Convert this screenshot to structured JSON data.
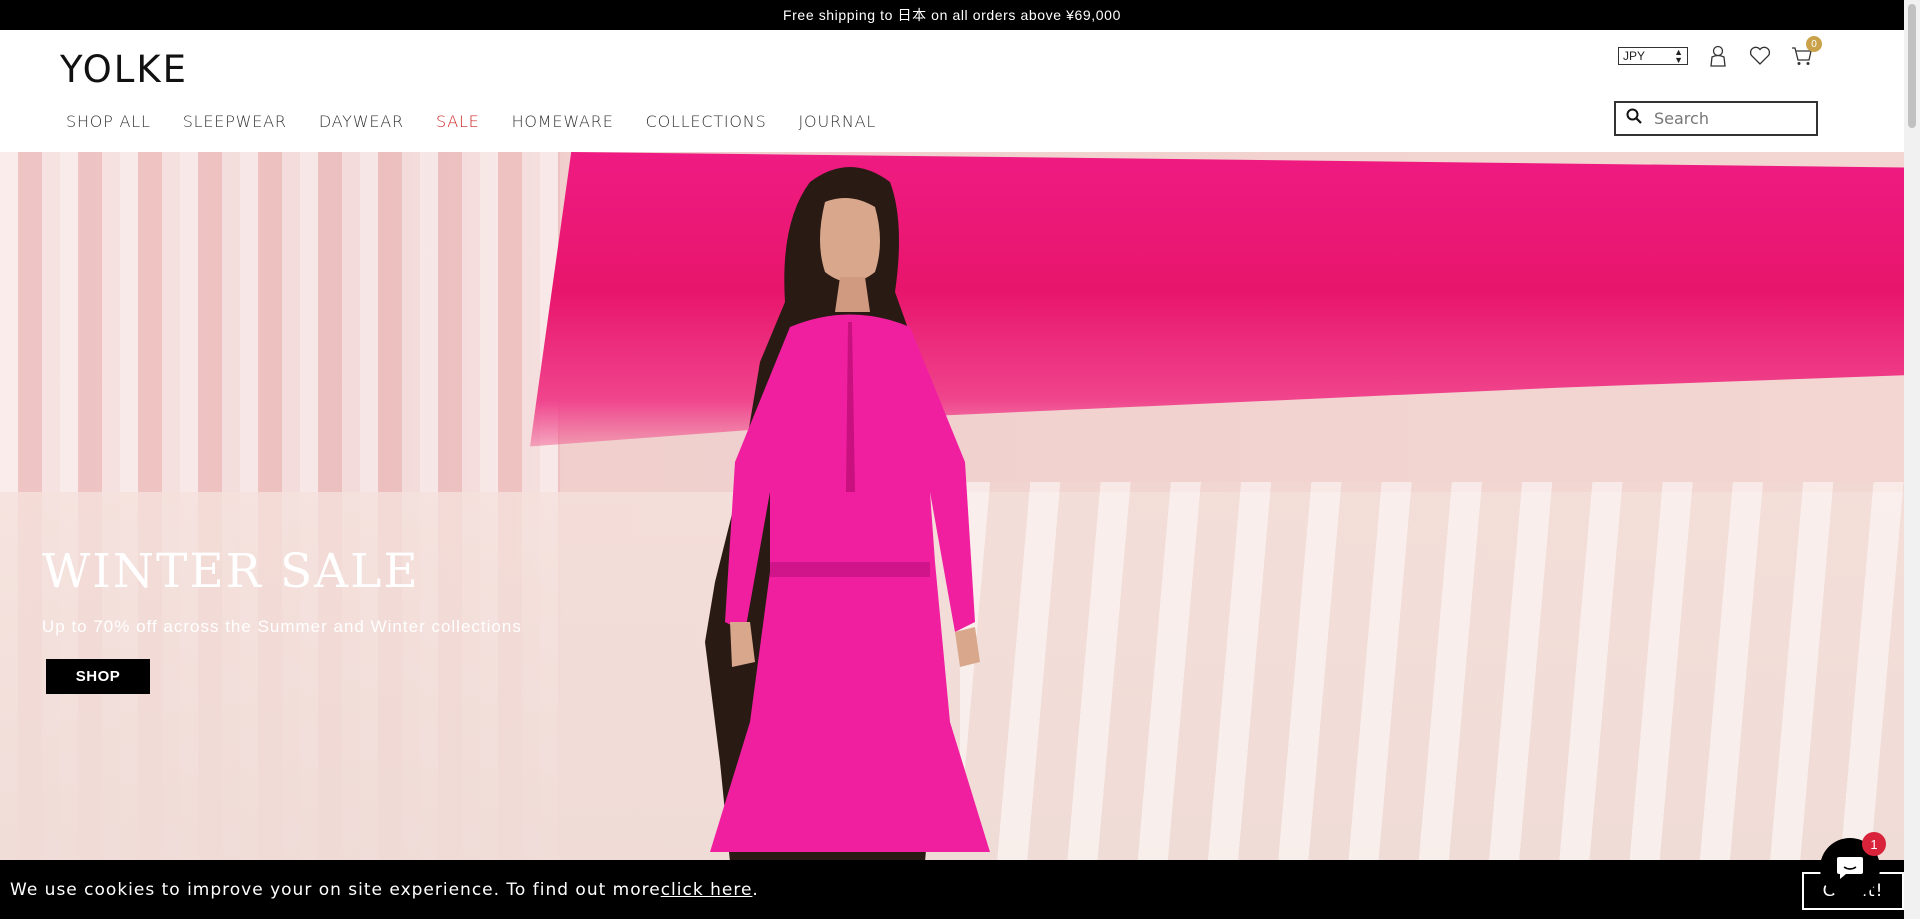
{
  "announcement": "Free shipping to 日本 on all orders above ¥69,000",
  "brand": "YOLKE",
  "nav": {
    "items": [
      {
        "label": "SHOP ALL"
      },
      {
        "label": "SLEEPWEAR"
      },
      {
        "label": "DAYWEAR"
      },
      {
        "label": "SALE"
      },
      {
        "label": "HOMEWARE"
      },
      {
        "label": "COLLECTIONS"
      },
      {
        "label": "JOURNAL"
      }
    ],
    "sale_color": "#cc2222"
  },
  "utils": {
    "currency": "JPY",
    "cart_count": "0",
    "icons": [
      "account-icon",
      "wishlist-heart-icon",
      "cart-icon"
    ],
    "badge_color": "#c9a24a"
  },
  "search": {
    "placeholder": "Search"
  },
  "hero": {
    "title": "WINTER SALE",
    "subtitle": "Up to 70% off across the Summer and Winter collections",
    "button": "SHOP",
    "accent_color": "#ef1b82"
  },
  "cookie": {
    "text": "We use cookies to improve your on site experience. To find out more ",
    "link": "click here",
    "end": ".",
    "button": "Got it!"
  },
  "chat": {
    "badge": "1"
  }
}
